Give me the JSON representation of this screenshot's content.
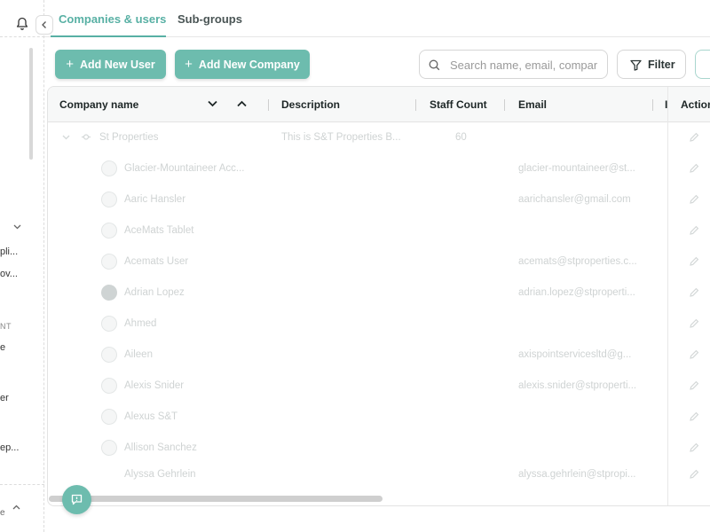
{
  "sidebar": {
    "items": [
      {
        "label": "pli..."
      },
      {
        "label": "ov..."
      },
      {
        "label": "NT"
      },
      {
        "label": "e"
      },
      {
        "label": "er"
      },
      {
        "label": "ep..."
      },
      {
        "label": "e"
      }
    ]
  },
  "tabs": [
    {
      "label": "Companies & users",
      "active": true
    },
    {
      "label": "Sub-groups",
      "active": false
    }
  ],
  "toolbar": {
    "add_user_label": "Add New User",
    "add_company_label": "Add New Company",
    "search_placeholder": "Search name, email, company",
    "filter_label": "Filter"
  },
  "table": {
    "columns": [
      "Company name",
      "Description",
      "Staff Count",
      "Email",
      "I",
      "Actions"
    ],
    "company_row": {
      "name": "St Properties",
      "description": "This is S&T Properties B...",
      "staff_count": "60"
    },
    "users": [
      {
        "name": "Glacier-Mountaineer Acc...",
        "email": "glacier-mountaineer@st..."
      },
      {
        "name": "Aaric Hansler",
        "email": "aarichansler@gmail.com"
      },
      {
        "name": "AceMats Tablet",
        "email": ""
      },
      {
        "name": "Acemats User",
        "email": "acemats@stproperties.c..."
      },
      {
        "name": "Adrian Lopez",
        "email": "adrian.lopez@stproperti..."
      },
      {
        "name": "Ahmed",
        "email": ""
      },
      {
        "name": "Aileen",
        "email": "axispointservicesltd@g..."
      },
      {
        "name": "Alexis Snider",
        "email": "alexis.snider@stproperti..."
      },
      {
        "name": "Alexus S&T",
        "email": ""
      },
      {
        "name": "Allison Sanchez",
        "email": ""
      },
      {
        "name": "Alyssa Gehrlein",
        "email": "alyssa.gehrlein@stpropi..."
      }
    ]
  },
  "colors": {
    "accent": "#58b0a4",
    "button": "#6dbcae"
  }
}
